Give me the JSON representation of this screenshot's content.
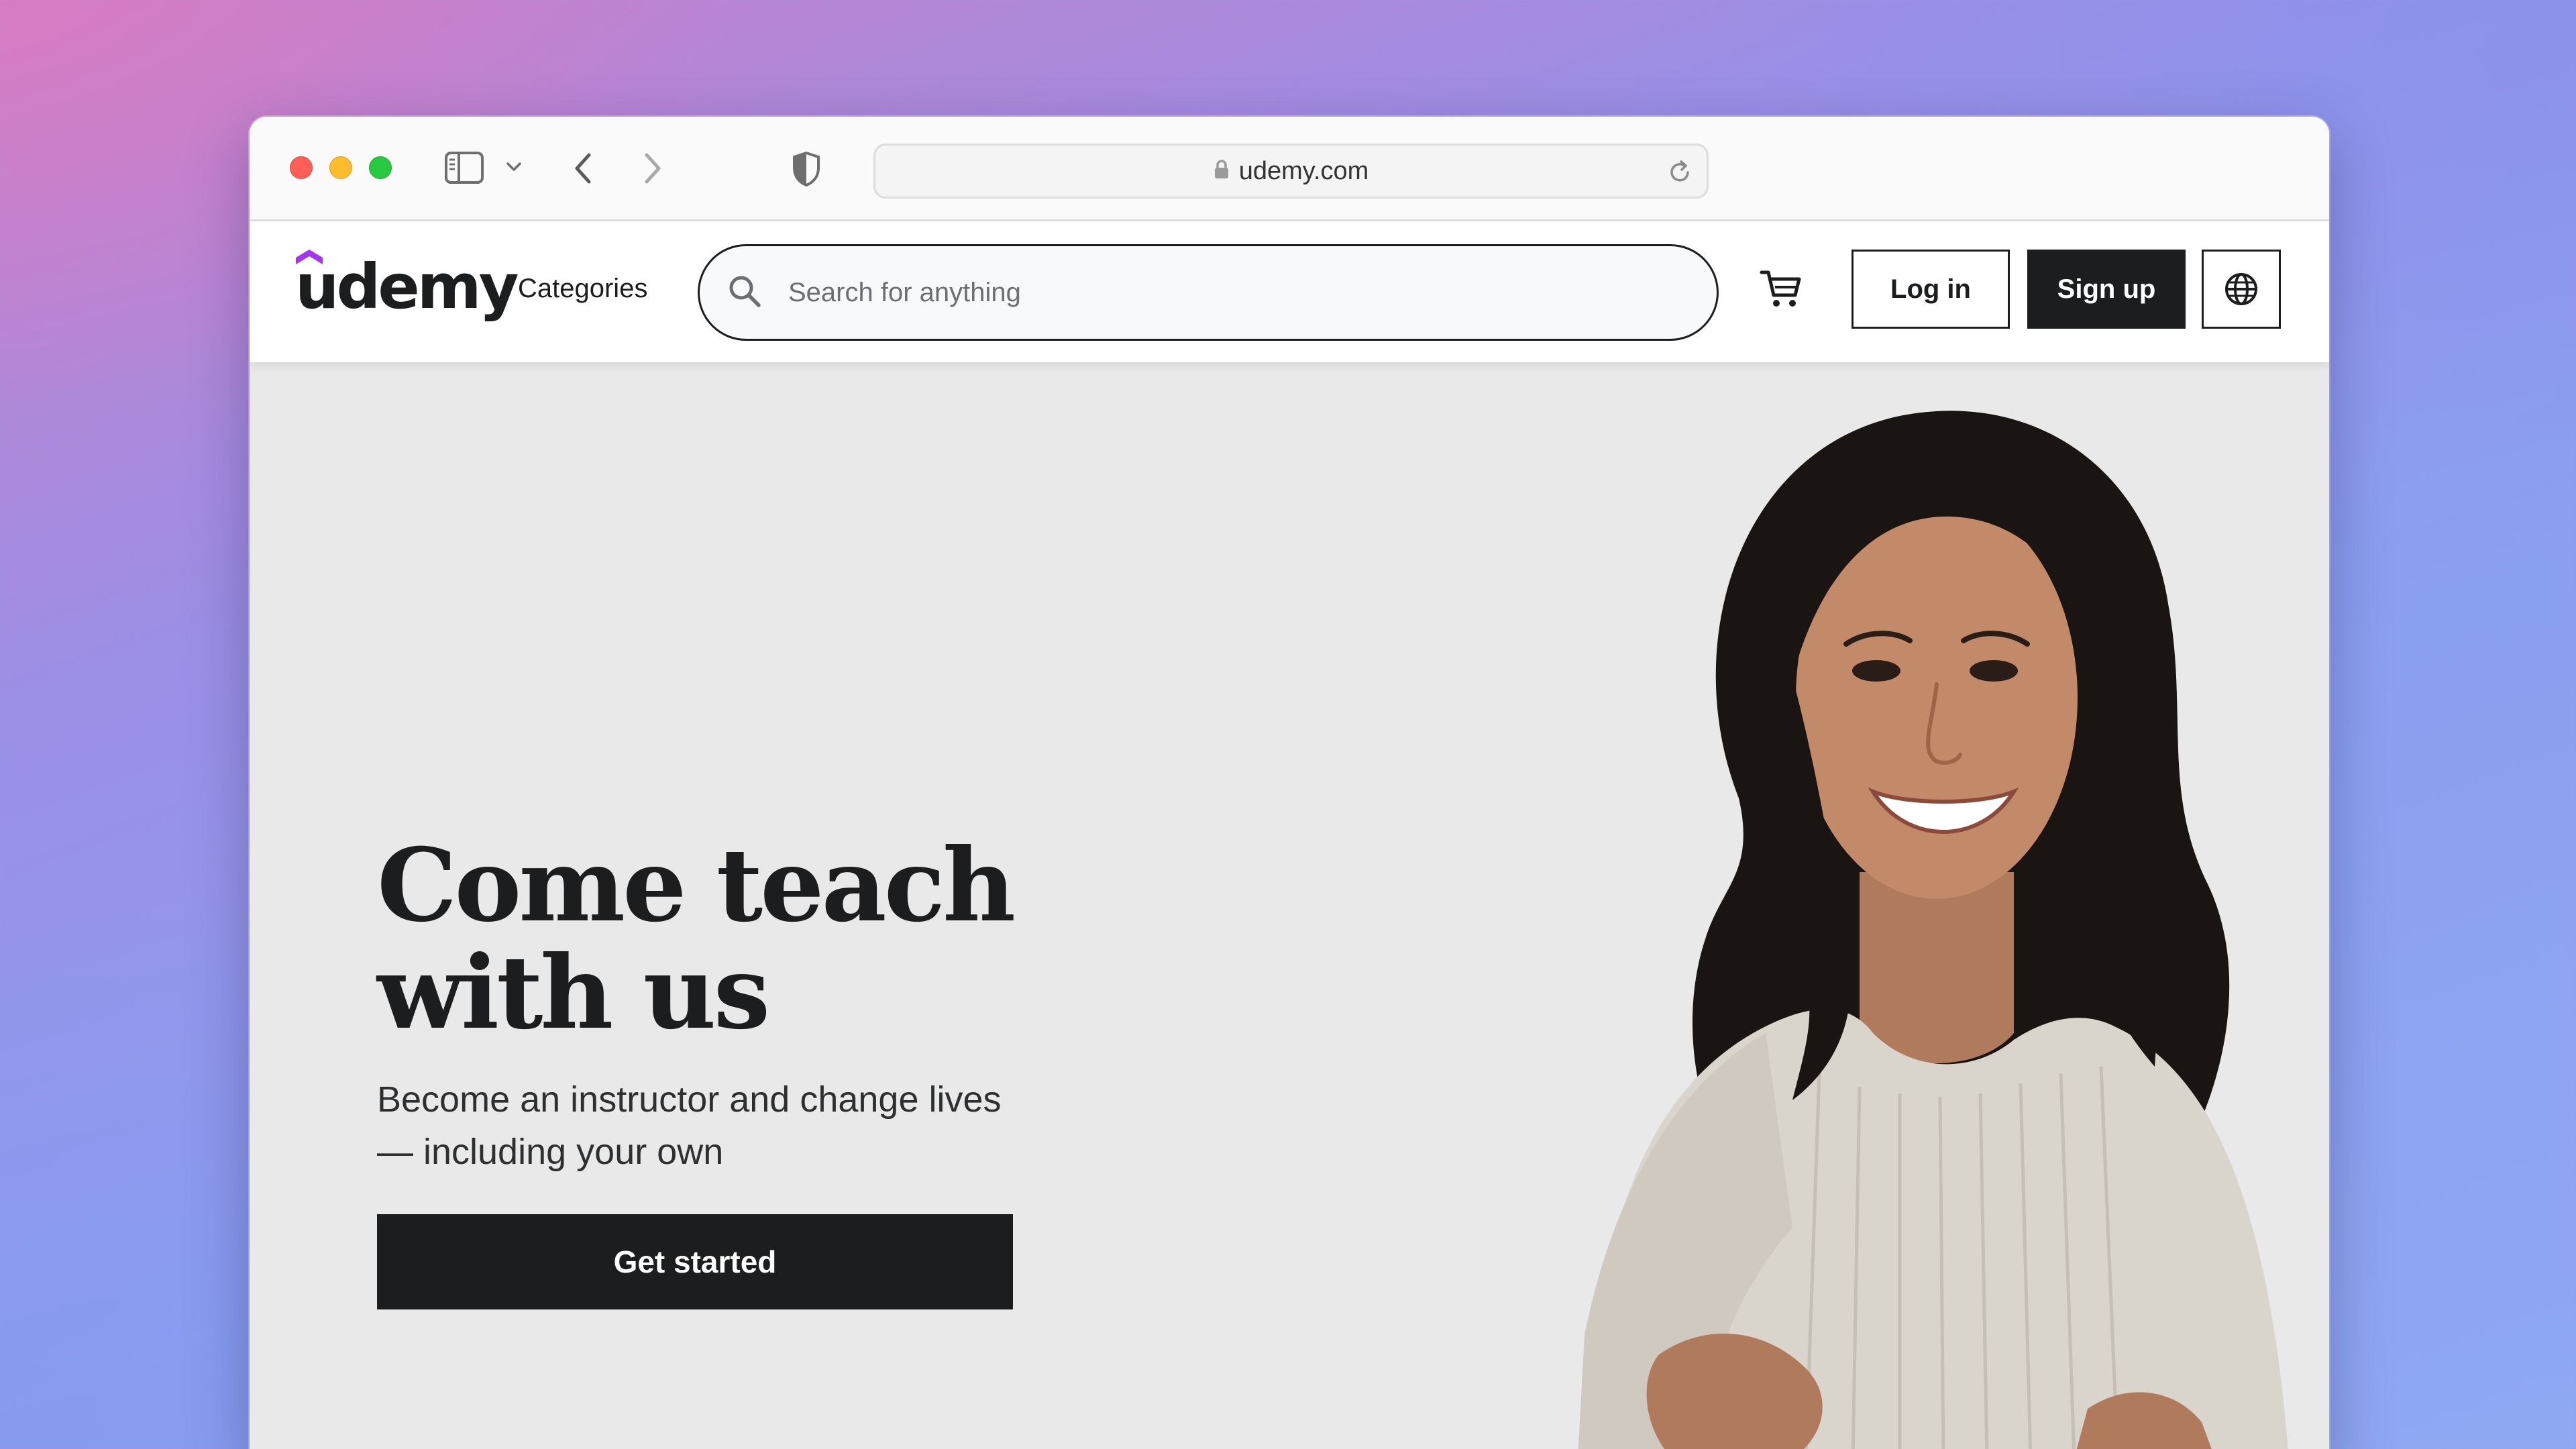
{
  "browser": {
    "url": "udemy.com"
  },
  "header": {
    "logo_text": "udemy",
    "categories_label": "Categories",
    "search_placeholder": "Search for anything",
    "login_label": "Log in",
    "signup_label": "Sign up"
  },
  "hero": {
    "title": "Come teach\nwith us",
    "subtitle": "Become an instructor and change lives — including your own",
    "cta_label": "Get started"
  },
  "colors": {
    "brand_purple": "#a435f0",
    "dark": "#1c1d1f",
    "hero_bg": "#e9e9e9"
  }
}
